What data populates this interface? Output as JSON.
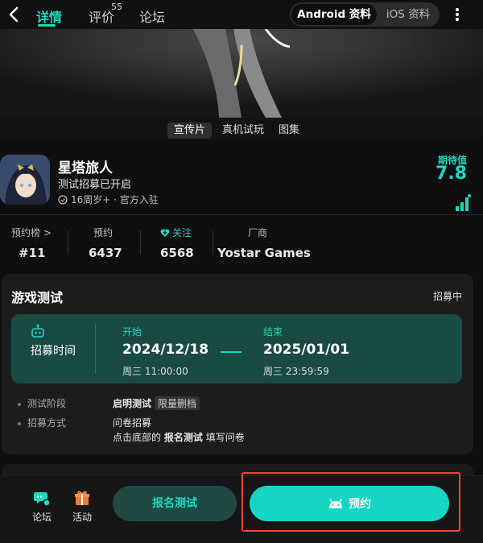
{
  "nav": {
    "tabs": [
      {
        "label": "详情",
        "active": true
      },
      {
        "label": "评价",
        "badge": "55"
      },
      {
        "label": "论坛"
      }
    ],
    "platform_options": [
      "Android 资料",
      "iOS 资料"
    ],
    "platform_selected": "Android 资料"
  },
  "media": {
    "tabs": [
      "宣传片",
      "真机试玩",
      "图集"
    ],
    "selected_tab": "宣传片"
  },
  "game": {
    "name": "星塔旅人",
    "status": "测试招募已开启",
    "meta": "16周岁+ · 官方入驻",
    "rating_label": "期待值",
    "rating_value": "7.8"
  },
  "stats": {
    "rank_label": "预约榜 >",
    "rank_value": "#11",
    "reserve_label": "预约",
    "reserve_value": "6437",
    "follow_label": "关注",
    "follow_value": "6568",
    "vendor_label": "厂商",
    "vendor_value": "Yostar Games"
  },
  "test": {
    "title": "游戏测试",
    "badge": "招募中",
    "period_label": "招募时间",
    "start_label": "开始",
    "start_date": "2024/12/18",
    "start_time": "周三 11:00:00",
    "end_label": "结束",
    "end_date": "2025/01/01",
    "end_time": "周三 23:59:59",
    "stage_label": "测试阶段",
    "stage_value": "启明测试",
    "stage_chip": "限量删档",
    "method_label": "招募方式",
    "method_value": "问卷招募",
    "method_note_pre": "点击底部的",
    "method_note_bold": "报名测试",
    "method_note_post": "填写问卷"
  },
  "bottom": {
    "forum_label": "论坛",
    "activity_label": "活动",
    "signup_label": "报名测试",
    "reserve_label": "预约"
  },
  "colors": {
    "accent": "#19d9bf",
    "button": "#14d6c2",
    "highlight": "#e64a2e",
    "background": "#0f0f0f"
  }
}
